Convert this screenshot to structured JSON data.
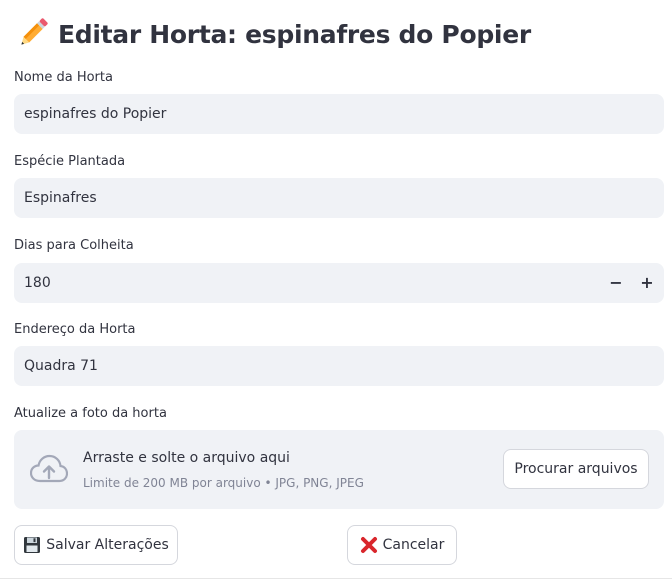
{
  "header": {
    "title": "Editar Horta: espinafres do Popier",
    "icon": "pencil-icon"
  },
  "form": {
    "name": {
      "label": "Nome da Horta",
      "value": "espinafres do Popier"
    },
    "species": {
      "label": "Espécie Plantada",
      "value": "Espinafres"
    },
    "days": {
      "label": "Dias para Colheita",
      "value": "180",
      "minus": "−",
      "plus": "+"
    },
    "address": {
      "label": "Endereço da Horta",
      "value": "Quadra 71"
    },
    "photo": {
      "label": "Atualize a foto da horta",
      "drop_text": "Arraste e solte o arquivo aqui",
      "limit_text": "Limite de 200 MB por arquivo • JPG, PNG, JPEG",
      "browse_label": "Procurar arquivos",
      "icon": "cloud-upload-icon"
    }
  },
  "actions": {
    "save_label": "Salvar Alterações",
    "save_icon": "floppy-disk-icon",
    "cancel_label": "Cancelar",
    "cancel_icon": "red-x-icon"
  },
  "colors": {
    "field_bg": "#f0f2f6",
    "text": "#31333f",
    "muted": "#808495",
    "cancel_red": "#d9262c"
  }
}
